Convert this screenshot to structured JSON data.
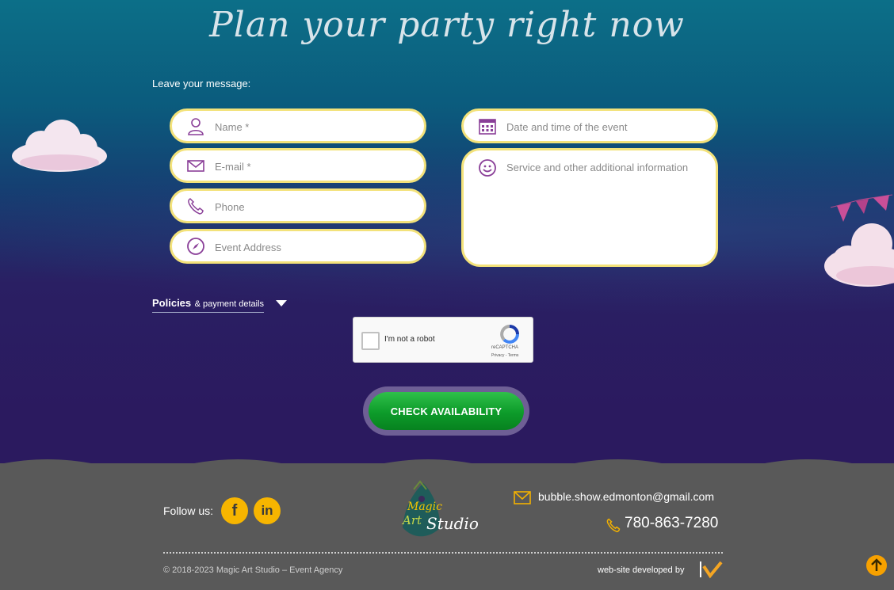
{
  "title": "Plan your party right now",
  "form": {
    "intro": "Leave your message:",
    "name_placeholder": "Name *",
    "email_placeholder": "E-mail *",
    "phone_placeholder": "Phone",
    "address_placeholder": "Event Address",
    "date_placeholder": "Date and time of the event",
    "message_placeholder": "Service and other additional information"
  },
  "policies": {
    "label": "Policies",
    "sub": "& payment details"
  },
  "captcha": {
    "label": "I'm not a robot",
    "brand": "reCAPTCHA",
    "links": "Privacy - Terms"
  },
  "cta": {
    "label": "CHECK AVAILABILITY"
  },
  "footer": {
    "follow": "Follow us:",
    "facebook": "f",
    "linkedin": "in",
    "logo_line1": "Magic",
    "logo_line2": "Art",
    "logo_line3": "Studio",
    "email": "bubble.show.edmonton@gmail.com",
    "phone": "780-863-7280",
    "copyright": "© 2018-2023 Magic Art Studio – Event Agency",
    "developed": "web-site developed by"
  },
  "colors": {
    "field_border": "#f3e27a",
    "cta_green": "#0d9b2a",
    "accent_orange": "#f7b500",
    "icon_purple": "#8a3f98",
    "footer_bg": "#595959"
  }
}
